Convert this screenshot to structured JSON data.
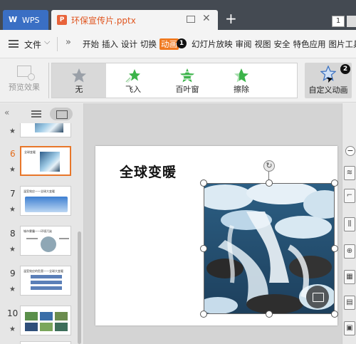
{
  "titlebar": {
    "app_tab": "WPS",
    "doc_tab": "环保宣传片.pptx",
    "new_tab_symbol": "+",
    "close_symbol": "✕",
    "window_badge": "1"
  },
  "menubar": {
    "file_label": "文件",
    "items": [
      {
        "label": "开始",
        "active": false
      },
      {
        "label": "插入",
        "active": false
      },
      {
        "label": "设计",
        "active": false
      },
      {
        "label": "切换",
        "active": false
      },
      {
        "label": "动画",
        "active": true
      },
      {
        "label": "幻灯片放映",
        "active": false
      },
      {
        "label": "审阅",
        "active": false
      },
      {
        "label": "视图",
        "active": false
      },
      {
        "label": "安全",
        "active": false
      },
      {
        "label": "特色应用",
        "active": false
      },
      {
        "label": "图片工具",
        "active": false
      }
    ],
    "step_marker_1": "❶"
  },
  "ribbon": {
    "preview_label": "预览效果",
    "gallery": [
      {
        "label": "无",
        "icon": "none-star-icon",
        "selected": true
      },
      {
        "label": "飞入",
        "icon": "fly-in-star-icon",
        "selected": false
      },
      {
        "label": "百叶窗",
        "icon": "blinds-star-icon",
        "selected": false
      },
      {
        "label": "擦除",
        "icon": "wipe-star-icon",
        "selected": false
      }
    ],
    "custom_label": "自定义动画",
    "step_marker_2": "❷"
  },
  "slides_panel": {
    "thumbnails": [
      {
        "number": "",
        "title": ""
      },
      {
        "number": "6",
        "title": "全球变暖",
        "selected": true
      },
      {
        "number": "7",
        "title": "温室效应——全球大变暖",
        "selected": false
      },
      {
        "number": "8",
        "title": "城市雾霾——环境污染",
        "selected": false
      },
      {
        "number": "9",
        "title": "温室效应的危害——全球大变暖",
        "selected": false
      },
      {
        "number": "10",
        "title": "",
        "selected": false
      }
    ]
  },
  "slide": {
    "title": "全球变暖"
  },
  "colors": {
    "accent": "#f07a20",
    "wps_blue": "#3a6fc4",
    "titlebar": "#444a52"
  }
}
